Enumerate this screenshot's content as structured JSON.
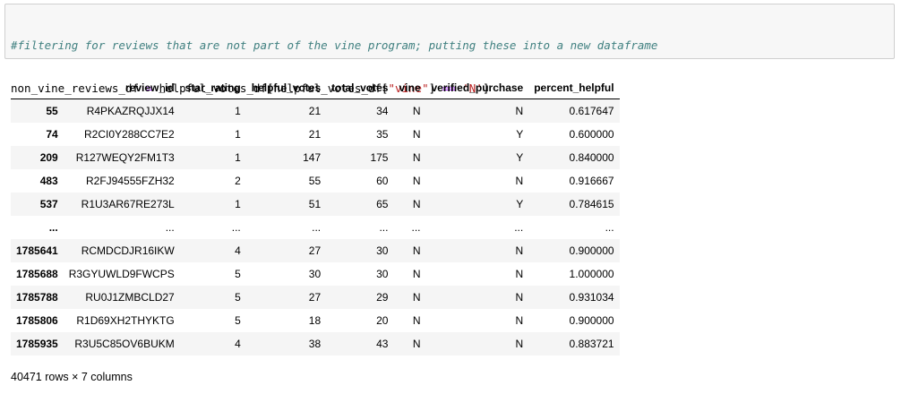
{
  "code_cell": {
    "line1_comment": "#filtering for reviews that are not part of the vine program; putting these into a new dataframe",
    "line2_lhs": "non_vine_reviews_df ",
    "line2_eq": "=",
    "line2_mid": " helpful_votes_df[helpful_votes_df[",
    "line2_str1": "\"vine\"",
    "line2_close": "] ",
    "line2_cmp": "==",
    "line2_space": " ",
    "line2_str2": "'N'",
    "line2_end": "]",
    "line3": "non_vine_reviews_df"
  },
  "table": {
    "index_header": "",
    "columns": [
      "review_id",
      "star_rating",
      "helpful_votes",
      "total_votes",
      "vine",
      "verified_purchase",
      "percent_helpful"
    ],
    "rows": [
      {
        "index": "55",
        "cells": [
          "R4PKAZRQJJX14",
          "1",
          "21",
          "34",
          "N",
          "N",
          "0.617647"
        ]
      },
      {
        "index": "74",
        "cells": [
          "R2CI0Y288CC7E2",
          "1",
          "21",
          "35",
          "N",
          "Y",
          "0.600000"
        ]
      },
      {
        "index": "209",
        "cells": [
          "R127WEQY2FM1T3",
          "1",
          "147",
          "175",
          "N",
          "Y",
          "0.840000"
        ]
      },
      {
        "index": "483",
        "cells": [
          "R2FJ94555FZH32",
          "2",
          "55",
          "60",
          "N",
          "N",
          "0.916667"
        ]
      },
      {
        "index": "537",
        "cells": [
          "R1U3AR67RE273L",
          "1",
          "51",
          "65",
          "N",
          "Y",
          "0.784615"
        ]
      },
      {
        "index": "...",
        "cells": [
          "...",
          "...",
          "...",
          "...",
          "...",
          "...",
          "..."
        ]
      },
      {
        "index": "1785641",
        "cells": [
          "RCMDCDJR16IKW",
          "4",
          "27",
          "30",
          "N",
          "N",
          "0.900000"
        ]
      },
      {
        "index": "1785688",
        "cells": [
          "R3GYUWLD9FWCPS",
          "5",
          "30",
          "30",
          "N",
          "N",
          "1.000000"
        ]
      },
      {
        "index": "1785788",
        "cells": [
          "RU0J1ZMBCLD27",
          "5",
          "27",
          "29",
          "N",
          "N",
          "0.931034"
        ]
      },
      {
        "index": "1785806",
        "cells": [
          "R1D69XH2THYKTG",
          "5",
          "18",
          "20",
          "N",
          "N",
          "0.900000"
        ]
      },
      {
        "index": "1785935",
        "cells": [
          "R3U5C85OV6BUKM",
          "4",
          "38",
          "43",
          "N",
          "N",
          "0.883721"
        ]
      }
    ]
  },
  "summary": "40471 rows × 7 columns"
}
